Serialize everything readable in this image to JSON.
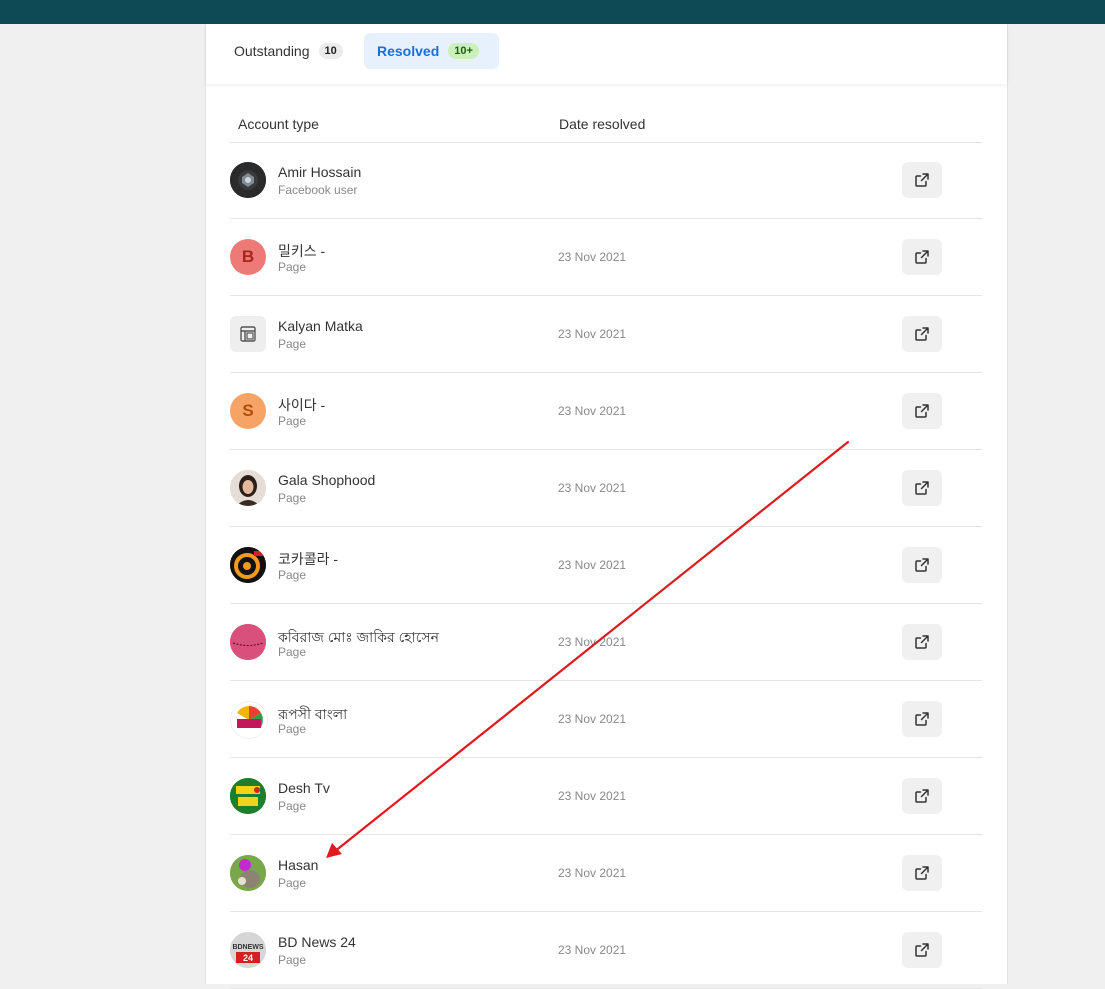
{
  "tabs": [
    {
      "label": "Outstanding",
      "count": "10"
    },
    {
      "label": "Resolved",
      "count": "10+"
    }
  ],
  "table": {
    "headers": {
      "account": "Account type",
      "date": "Date resolved"
    },
    "rows": [
      {
        "name": "Amir Hossain",
        "type": "Facebook user",
        "date": ""
      },
      {
        "name": "밀키스 -",
        "type": "Page",
        "date": "23 Nov 2021"
      },
      {
        "name": "Kalyan Matka",
        "type": "Page",
        "date": "23 Nov 2021"
      },
      {
        "name": "사이다 -",
        "type": "Page",
        "date": "23 Nov 2021"
      },
      {
        "name": "Gala Shophood",
        "type": "Page",
        "date": "23 Nov 2021"
      },
      {
        "name": "코카콜라 -",
        "type": "Page",
        "date": "23 Nov 2021"
      },
      {
        "name": "কবিরাজ মোঃ জাকির হোসেন",
        "type": "Page",
        "date": "23 Nov 2021"
      },
      {
        "name": "রূপসী বাংলা",
        "type": "Page",
        "date": "23 Nov 2021"
      },
      {
        "name": "Desh Tv",
        "type": "Page",
        "date": "23 Nov 2021"
      },
      {
        "name": "Hasan",
        "type": "Page",
        "date": "23 Nov 2021"
      },
      {
        "name": "BD News 24",
        "type": "Page",
        "date": "23 Nov 2021"
      }
    ]
  },
  "avatars": {
    "letter_b": "B",
    "letter_s": "S",
    "bdnews_top": "BDNEWS",
    "bdnews_bottom": "24"
  },
  "colors": {
    "topbar": "#0d4a56",
    "accent": "#1a6fd6",
    "annotation_arrow": "#e0191c"
  },
  "icons": {
    "open_button": "external-link-icon",
    "page_placeholder": "page-icon"
  }
}
